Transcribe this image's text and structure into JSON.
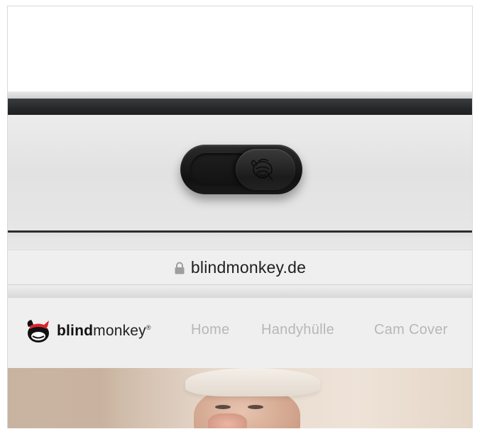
{
  "browser": {
    "url": "blindmonkey.de",
    "lock_icon": "lock-icon"
  },
  "site": {
    "logo": {
      "bold": "blind",
      "light": "monkey",
      "mark": "®",
      "icon": "monkey-logo-icon"
    },
    "nav": [
      {
        "label": "Home"
      },
      {
        "label": "Handyhülle"
      },
      {
        "label": "Cam Cover"
      }
    ]
  },
  "device": {
    "cam_cover_icon": "monkey-logo-icon"
  },
  "colors": {
    "bezel": "#262829",
    "nav_text": "#b7b7b7",
    "logo_red": "#d8262d"
  }
}
